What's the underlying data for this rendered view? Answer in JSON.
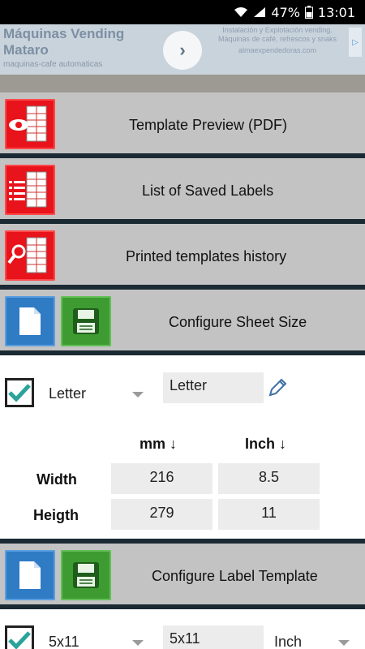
{
  "status_bar": {
    "battery": "47%",
    "time": "13:01"
  },
  "ad": {
    "title": "Máquinas Vending Mataro",
    "subtitle": "maquinas-cafe automaticas",
    "button": "›",
    "right_text": "Instalación y Explotación vending. Máquinas de café, refrescos y snaks",
    "right_url": "almaexpendedoras.com",
    "badge": "▷"
  },
  "menu": {
    "template_preview": "Template Preview (PDF)",
    "saved_labels": "List of Saved Labels",
    "printed_history": "Printed templates history",
    "configure_sheet": "Configure Sheet Size",
    "configure_label": "Configure Label Template"
  },
  "sheet": {
    "checked": true,
    "selected_size": "Letter",
    "name_value": "Letter",
    "col_mm": "mm ↓",
    "col_inch": "Inch ↓",
    "width_label": "Width",
    "height_label": "Heigth",
    "width_mm": "216",
    "width_inch": "8.5",
    "height_mm": "279",
    "height_inch": "11"
  },
  "label_template": {
    "checked": true,
    "selected_template": "5x11",
    "name_value": "5x11",
    "unit": "Inch"
  },
  "colors": {
    "red_icon": "#e8131b",
    "blue_icon": "#2f7bc4",
    "green_icon": "#3d9b32",
    "check_teal": "#2aa39a",
    "row_gray": "#c3c3c3",
    "divider": "#1b2a33"
  }
}
